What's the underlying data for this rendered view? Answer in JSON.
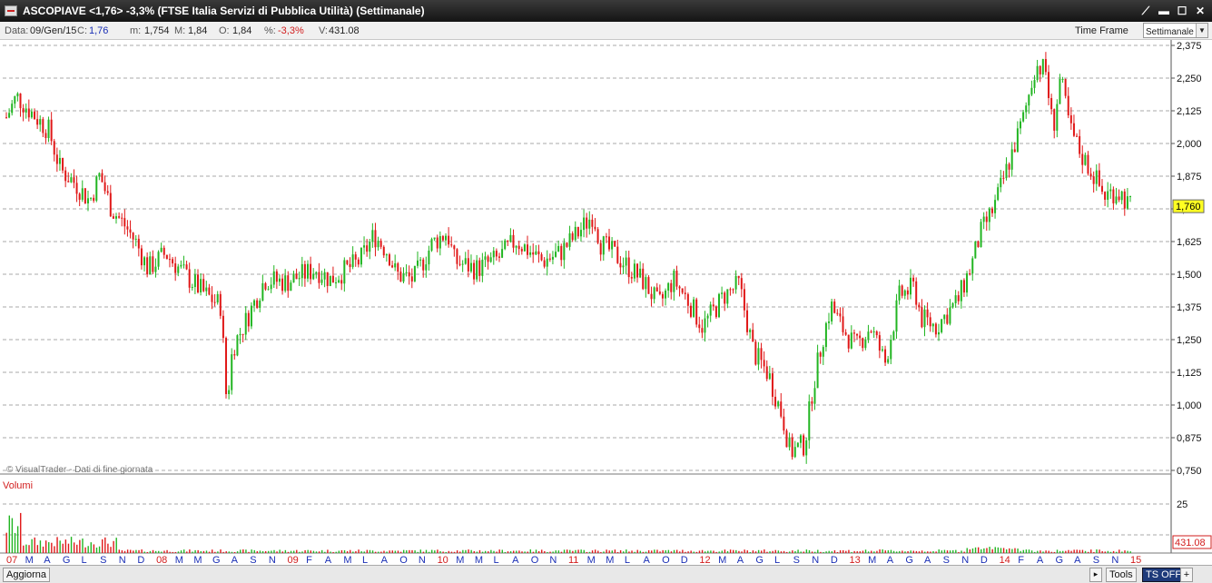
{
  "window": {
    "title": "ASCOPIAVE <1,76> -3,3%  (FTSE Italia Servizi di Pubblica Utilità)  (Settimanale)",
    "buttons": [
      "⟋",
      "▬",
      "☐",
      "✕"
    ]
  },
  "infobar": {
    "date_label": "Data:",
    "date_value": "09/Gen/15",
    "close_label": "C:",
    "close_value": "1,76",
    "min_label": "m:",
    "min_value": "1,754",
    "max_label": "M:",
    "max_value": "1,84",
    "open_label": "O:",
    "open_value": "1,84",
    "pct_label": "%:",
    "pct_value": "-3,3%",
    "vol_label": "V:",
    "vol_value": "431.08",
    "timeframe_label": "Time Frame",
    "timeframe_value": "Settimanale"
  },
  "bottom": {
    "refresh_button": "Aggiorna",
    "tools_button": "Tools",
    "ts_button": "TS OFF",
    "plus_button": "+",
    "more_button": "▸"
  },
  "colors": {
    "up": "#22b522",
    "down": "#e01818",
    "grid": "#a8a8a8",
    "last_price_bg": "#ffff22",
    "axis_month": "#1a2fb5",
    "axis_year": "#d21d1d"
  },
  "chart_data": {
    "type": "candlestick",
    "watermark": "© VisualTrader - Dati di fine giornata",
    "volume_label": "Volumi",
    "price_axis_ticks": [
      "2,375",
      "2,250",
      "2,125",
      "2,000",
      "1,875",
      "1,750",
      "1,625",
      "1,500",
      "1,375",
      "1,250",
      "1,125",
      "1,000",
      "0,875",
      "0,750"
    ],
    "price_tick_values": [
      2.375,
      2.25,
      2.125,
      2.0,
      1.875,
      1.75,
      1.625,
      1.5,
      1.375,
      1.25,
      1.125,
      1.0,
      0.875,
      0.75
    ],
    "ylim": [
      0.75,
      2.375
    ],
    "last_price": "1,760",
    "last_price_value": 1.76,
    "volume_axis_tick": "25",
    "volume_tick_value": 25,
    "last_volume": "431.08",
    "x_labels": [
      "07",
      "M",
      "A",
      "G",
      "L",
      "S",
      "N",
      "D",
      "08",
      "M",
      "M",
      "G",
      "A",
      "S",
      "N",
      "09",
      "F",
      "A",
      "M",
      "L",
      "A",
      "O",
      "N",
      "10",
      "M",
      "M",
      "L",
      "A",
      "O",
      "N",
      "11",
      "M",
      "M",
      "L",
      "A",
      "O",
      "D",
      "12",
      "M",
      "A",
      "G",
      "L",
      "S",
      "N",
      "D",
      "13",
      "M",
      "A",
      "G",
      "A",
      "S",
      "N",
      "D",
      "14",
      "F",
      "A",
      "G",
      "A",
      "S",
      "N",
      "15"
    ],
    "x_label_is_year": [
      true,
      false,
      false,
      false,
      false,
      false,
      false,
      false,
      true,
      false,
      false,
      false,
      false,
      false,
      false,
      true,
      false,
      false,
      false,
      false,
      false,
      false,
      false,
      true,
      false,
      false,
      false,
      false,
      false,
      false,
      true,
      false,
      false,
      false,
      false,
      false,
      false,
      true,
      false,
      false,
      false,
      false,
      false,
      false,
      false,
      true,
      false,
      false,
      false,
      false,
      false,
      false,
      false,
      true,
      false,
      false,
      false,
      false,
      false,
      false,
      true
    ],
    "price_path": [
      [
        2007.33,
        2.1
      ],
      [
        2007.4,
        2.18
      ],
      [
        2007.5,
        2.12
      ],
      [
        2007.62,
        2.05
      ],
      [
        2007.7,
        1.9
      ],
      [
        2007.8,
        1.85
      ],
      [
        2007.9,
        1.78
      ],
      [
        2007.97,
        1.88
      ],
      [
        2008.05,
        1.75
      ],
      [
        2008.15,
        1.68
      ],
      [
        2008.22,
        1.62
      ],
      [
        2008.3,
        1.52
      ],
      [
        2008.42,
        1.58
      ],
      [
        2008.55,
        1.5
      ],
      [
        2008.7,
        1.42
      ],
      [
        2008.8,
        1.38
      ],
      [
        2008.84,
        1.0
      ],
      [
        2008.88,
        1.22
      ],
      [
        2008.97,
        1.32
      ],
      [
        2009.1,
        1.48
      ],
      [
        2009.25,
        1.47
      ],
      [
        2009.45,
        1.52
      ],
      [
        2009.55,
        1.48
      ],
      [
        2009.75,
        1.55
      ],
      [
        2009.85,
        1.65
      ],
      [
        2009.95,
        1.58
      ],
      [
        2010.0,
        1.5
      ],
      [
        2010.12,
        1.48
      ],
      [
        2010.25,
        1.62
      ],
      [
        2010.35,
        1.66
      ],
      [
        2010.4,
        1.55
      ],
      [
        2010.55,
        1.52
      ],
      [
        2010.7,
        1.56
      ],
      [
        2010.82,
        1.63
      ],
      [
        2011.0,
        1.55
      ],
      [
        2011.12,
        1.58
      ],
      [
        2011.25,
        1.66
      ],
      [
        2011.35,
        1.73
      ],
      [
        2011.4,
        1.62
      ],
      [
        2011.55,
        1.55
      ],
      [
        2011.7,
        1.47
      ],
      [
        2011.8,
        1.38
      ],
      [
        2011.9,
        1.48
      ],
      [
        2012.0,
        1.4
      ],
      [
        2012.1,
        1.3
      ],
      [
        2012.25,
        1.42
      ],
      [
        2012.35,
        1.46
      ],
      [
        2012.45,
        1.2
      ],
      [
        2012.55,
        1.12
      ],
      [
        2012.65,
        0.95
      ],
      [
        2012.7,
        0.82
      ],
      [
        2012.8,
        0.85
      ],
      [
        2012.85,
        1.05
      ],
      [
        2012.92,
        1.25
      ],
      [
        2012.98,
        1.38
      ],
      [
        2013.05,
        1.3
      ],
      [
        2013.15,
        1.22
      ],
      [
        2013.25,
        1.3
      ],
      [
        2013.35,
        1.16
      ],
      [
        2013.45,
        1.42
      ],
      [
        2013.55,
        1.45
      ],
      [
        2013.6,
        1.33
      ],
      [
        2013.7,
        1.3
      ],
      [
        2013.85,
        1.4
      ],
      [
        2013.95,
        1.55
      ],
      [
        2014.0,
        1.65
      ],
      [
        2014.1,
        1.76
      ],
      [
        2014.2,
        1.93
      ],
      [
        2014.3,
        2.1
      ],
      [
        2014.38,
        2.3
      ],
      [
        2014.45,
        2.28
      ],
      [
        2014.5,
        2.05
      ],
      [
        2014.55,
        2.25
      ],
      [
        2014.62,
        2.05
      ],
      [
        2014.7,
        1.95
      ],
      [
        2014.78,
        1.88
      ],
      [
        2014.85,
        1.8
      ],
      [
        2014.93,
        1.82
      ],
      [
        2014.98,
        1.8
      ],
      [
        2015.02,
        1.76
      ]
    ],
    "x_range": [
      2007.33,
      2015.03
    ]
  }
}
